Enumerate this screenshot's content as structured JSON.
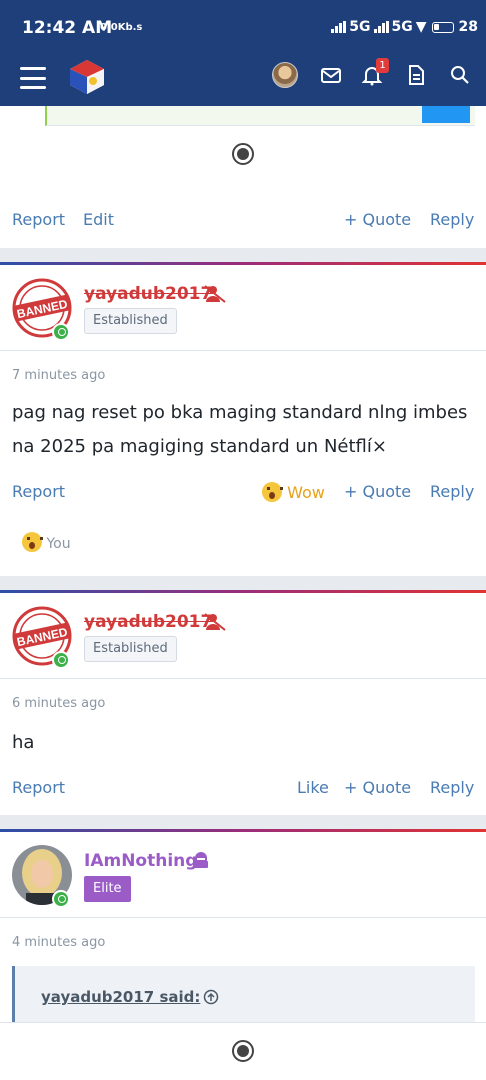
{
  "statusbar": {
    "time": "12:42 AM",
    "speed": "0.0Kb.s",
    "net1": "5G",
    "net2": "5G",
    "battery": "28"
  },
  "appbar": {
    "notification_count": "1"
  },
  "colors": {
    "appbar": "#1f3f7a",
    "link": "#4a7bb3",
    "banned_name": "#d03a3a",
    "elite": "#9b5cc7",
    "wow": "#e6a31a"
  },
  "icons": [
    "menu-icon",
    "site-logo",
    "user-avatar",
    "mail-icon",
    "bell-icon",
    "document-icon",
    "search-icon",
    "online-indicator",
    "banned-user-icon",
    "hooded-user-icon",
    "wow-emoji",
    "quote-arrow-icon",
    "loading-spinner"
  ],
  "post0": {
    "actions": {
      "report": "Report",
      "edit": "Edit",
      "quote": "+ Quote",
      "reply": "Reply"
    }
  },
  "post1": {
    "username": "yayadub2017",
    "badge": "Established",
    "avatar_text": "BANNED",
    "time": "7 minutes ago",
    "message": "pag nag reset po bka maging standard nlng imbes na 2025 pa magiging standard un Nétflí×",
    "actions": {
      "report": "Report",
      "reaction": "Wow",
      "quote": "+ Quote",
      "reply": "Reply"
    },
    "reacted_by": "You"
  },
  "post2": {
    "username": "yayadub2017",
    "badge": "Established",
    "avatar_text": "BANNED",
    "time": "6 minutes ago",
    "message": "ha",
    "actions": {
      "report": "Report",
      "like": "Like",
      "quote": "+ Quote",
      "reply": "Reply"
    }
  },
  "post3": {
    "username": "IAmNothing",
    "badge": "Elite",
    "time": "4 minutes ago",
    "quote_author": "yayadub2017 said:"
  }
}
